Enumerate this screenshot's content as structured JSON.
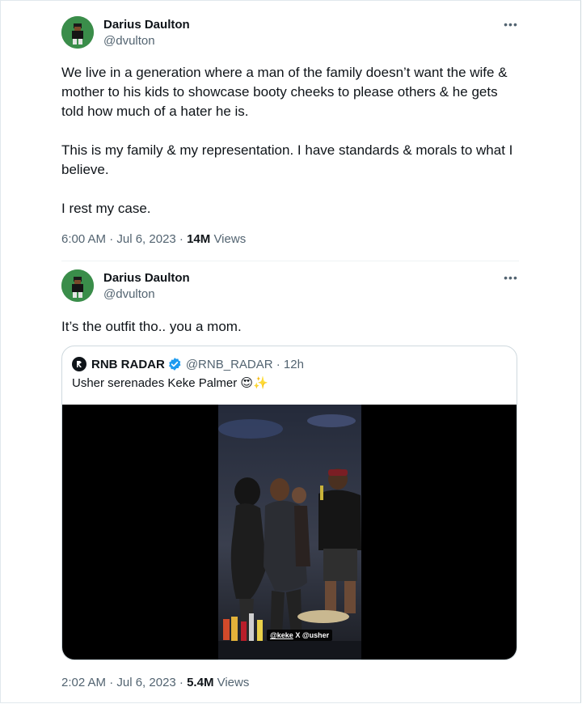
{
  "tweet1": {
    "name": "Darius Daulton",
    "handle": "@dvulton",
    "paragraphs": [
      "We live in a generation where a man of the family doesn’t want the wife & mother to his kids to showcase booty cheeks to please others & he gets told how much of a hater he is.",
      "This is my family & my representation. I have standards & morals to what I believe.",
      "I rest my case."
    ],
    "time": "6:00 AM · Jul 6, 2023 · ",
    "views_count": "14M",
    "views_label": " Views"
  },
  "tweet2": {
    "name": "Darius Daulton",
    "handle": "@dvulton",
    "text": "It’s the outfit tho.. you a mom.",
    "quote": {
      "name": "RNB RADAR",
      "handle": "@RNB_RADAR · 12h",
      "text": "Usher serenades Keke Palmer 😍✨",
      "video_tag_a": "@keke",
      "video_tag_b": " X @usher"
    },
    "time": "2:02 AM · Jul 6, 2023 · ",
    "views_count": "5.4M",
    "views_label": " Views"
  },
  "icons": {
    "more": "more-horizontal-icon",
    "verified": "verified-badge-icon"
  },
  "colors": {
    "text": "#0f1419",
    "secondary": "#536471",
    "verified": "#1d9bf0",
    "avatar_bg": "#3a8d4a"
  }
}
